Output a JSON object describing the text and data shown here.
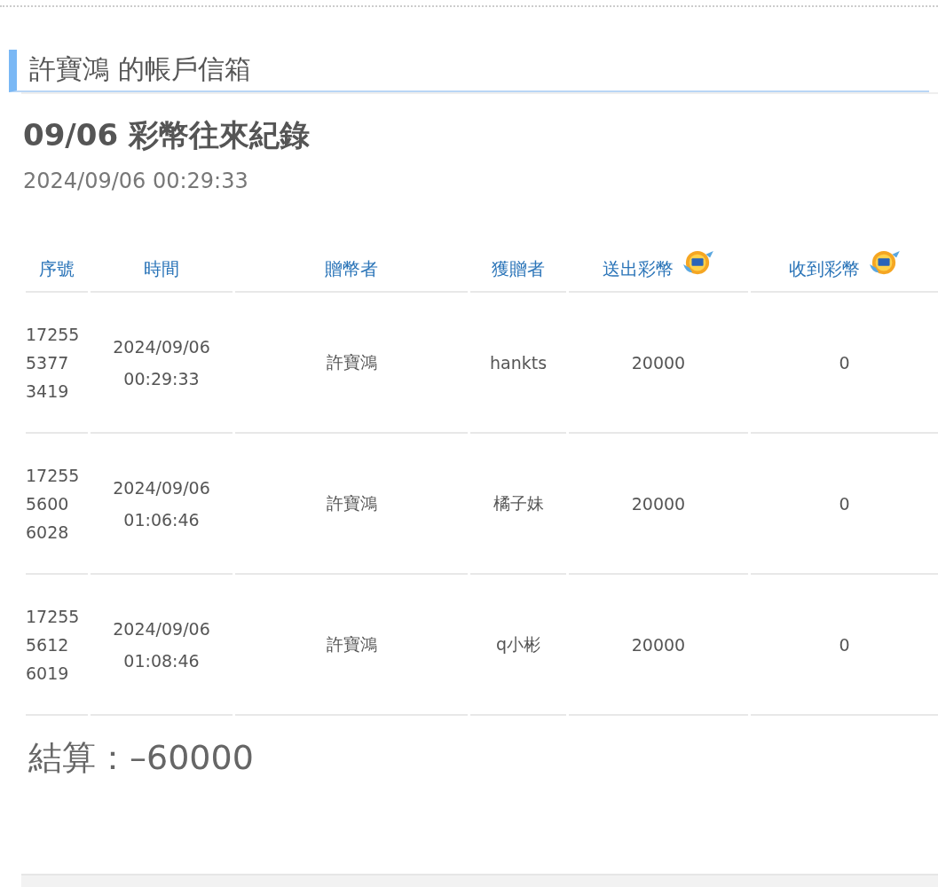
{
  "section_title": "許寶鴻 的帳戶信箱",
  "heading": "09/06 彩幣往來紀錄",
  "timestamp": "2024/09/06 00:29:33",
  "table": {
    "columns": [
      {
        "label": "序號",
        "coin_icon": false
      },
      {
        "label": "時間",
        "coin_icon": false
      },
      {
        "label": "贈幣者",
        "coin_icon": false
      },
      {
        "label": "獲贈者",
        "coin_icon": false
      },
      {
        "label": "送出彩幣",
        "coin_icon": true
      },
      {
        "label": "收到彩幣",
        "coin_icon": true
      }
    ],
    "rows": [
      {
        "serial": [
          "17255",
          "5377",
          "3419"
        ],
        "time": [
          "2024/09/06",
          "00:29:33"
        ],
        "giver": "許寶鴻",
        "receiver": "hankts",
        "sent": "20000",
        "received": "0"
      },
      {
        "serial": [
          "17255",
          "5600",
          "6028"
        ],
        "time": [
          "2024/09/06",
          "01:06:46"
        ],
        "giver": "許寶鴻",
        "receiver": "橘子妹",
        "sent": "20000",
        "received": "0"
      },
      {
        "serial": [
          "17255",
          "5612",
          "6019"
        ],
        "time": [
          "2024/09/06",
          "01:08:46"
        ],
        "giver": "許寶鴻",
        "receiver": "q小彬",
        "sent": "20000",
        "received": "0"
      }
    ]
  },
  "total": "結算：–60000"
}
